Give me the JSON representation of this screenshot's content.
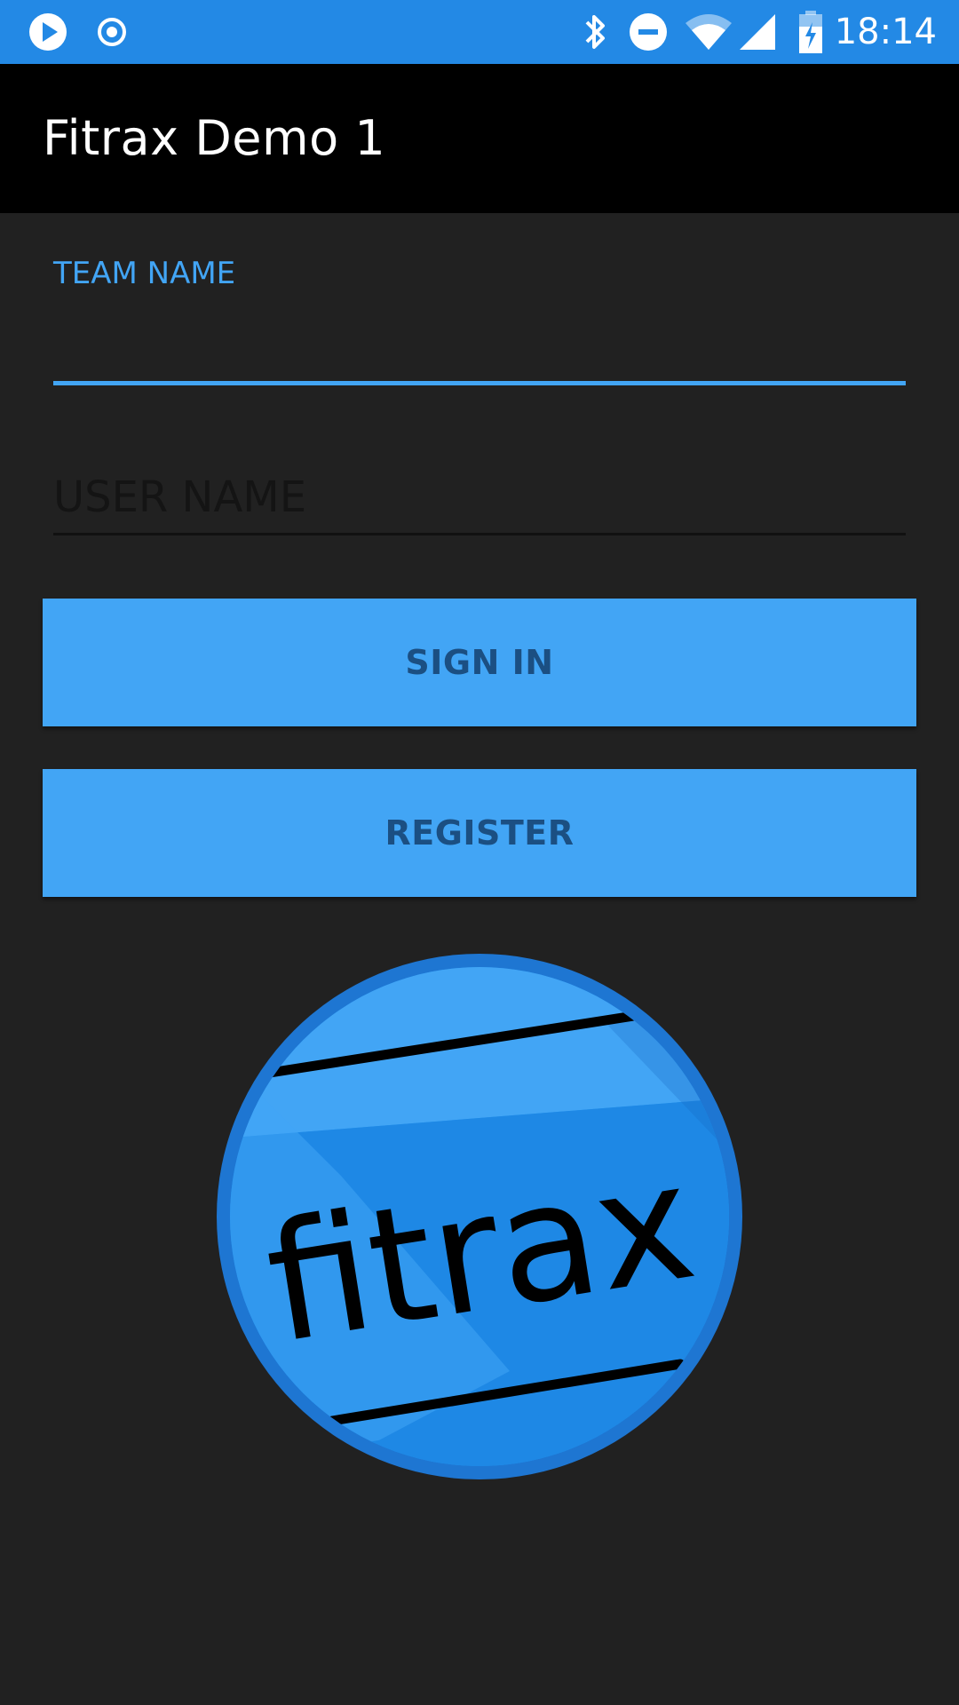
{
  "status_bar": {
    "time": "18:14",
    "color": "#2389e5",
    "left_icons": [
      "play-store-icon",
      "record-icon"
    ],
    "right_icons": [
      "bluetooth-icon",
      "do-not-disturb-icon",
      "wifi-icon",
      "cell-signal-icon",
      "battery-charging-icon"
    ]
  },
  "app_bar": {
    "title": "Fitrax Demo 1",
    "color": "#000000"
  },
  "form": {
    "team_name": {
      "label": "TEAM NAME",
      "value": ""
    },
    "user_name": {
      "placeholder": "USER NAME",
      "value": ""
    },
    "sign_in_label": "SIGN IN",
    "register_label": "REGISTER",
    "accent_color": "#42a5f5"
  },
  "logo": {
    "text": "fitrax",
    "colors": {
      "outer": "#1e76d2",
      "inner": "#2196f3",
      "stripe": "#000000"
    }
  }
}
